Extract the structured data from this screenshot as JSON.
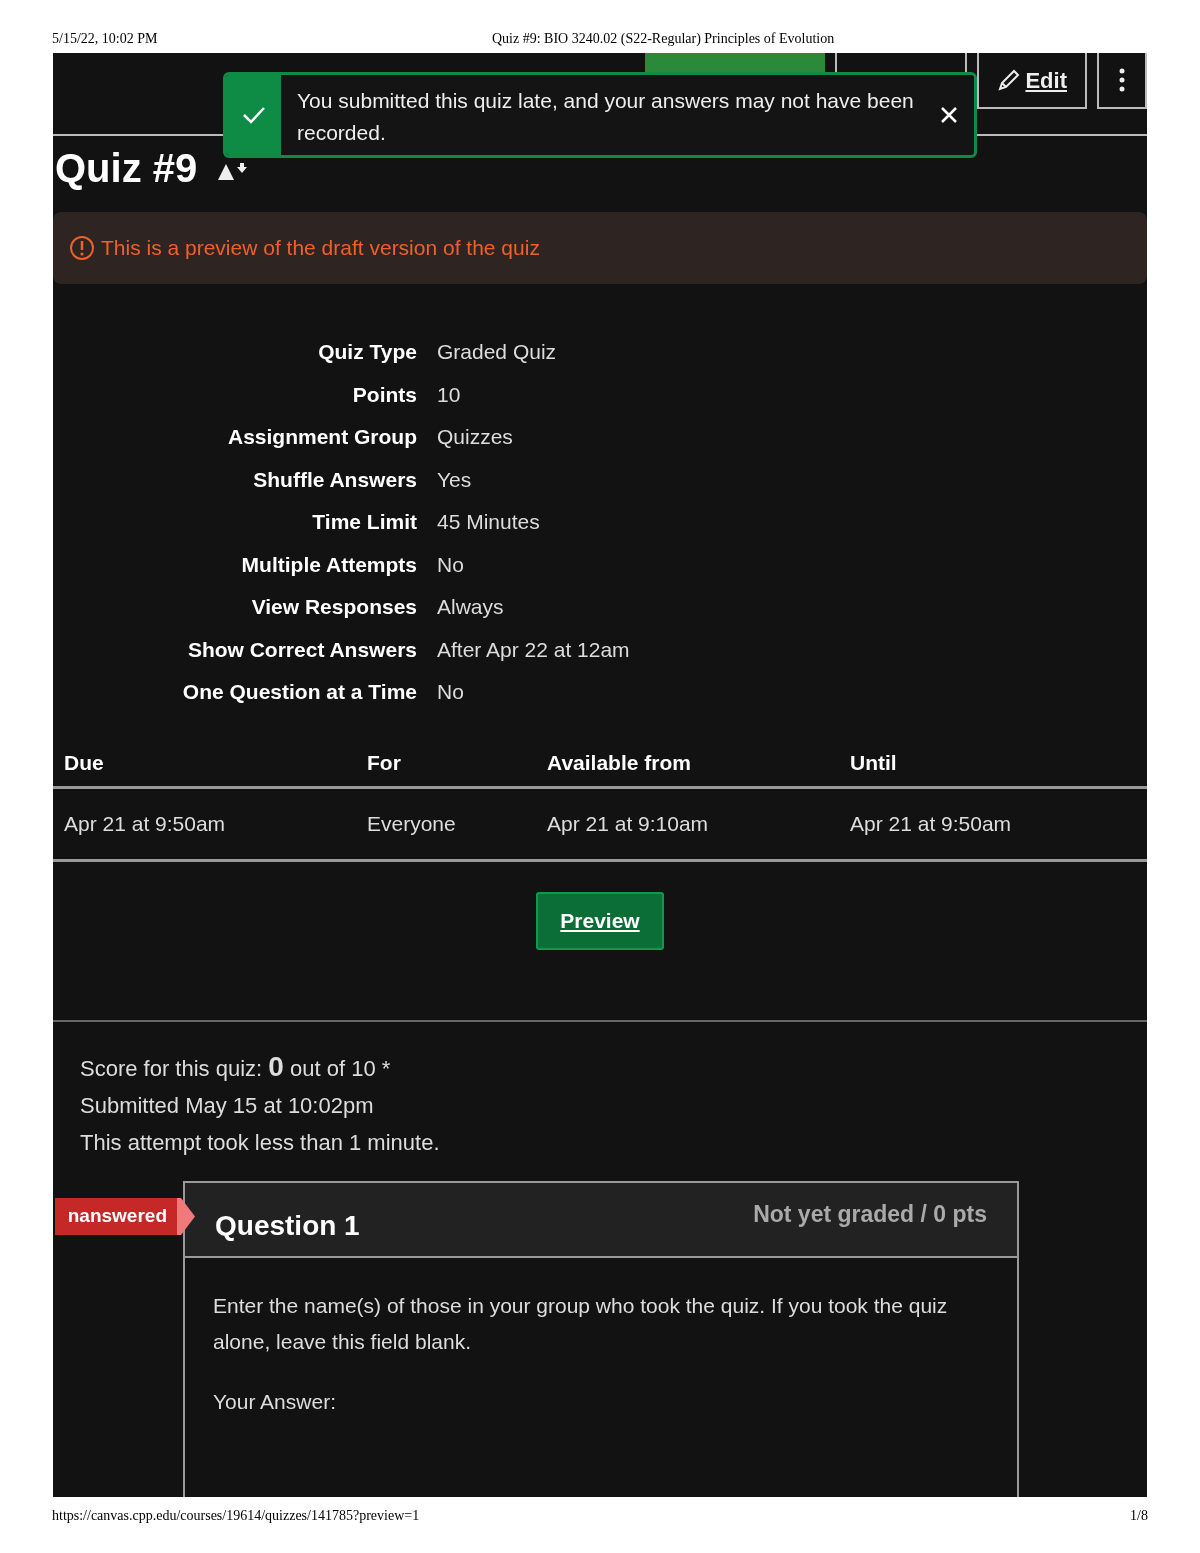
{
  "print_header": {
    "date": "5/15/22, 10:02 PM",
    "title": "Quiz #9: BIO 3240.02 (S22-Regular) Principles of Evolution"
  },
  "toolbar": {
    "edit": "Edit"
  },
  "toast": {
    "message": "You submitted this quiz late, and your answers may not have been recorded."
  },
  "quiz_title": "Quiz #9",
  "preview_notice": "This is a preview of the draft version of the quiz",
  "details": [
    {
      "label": "Quiz Type",
      "value": "Graded Quiz"
    },
    {
      "label": "Points",
      "value": "10"
    },
    {
      "label": "Assignment Group",
      "value": "Quizzes"
    },
    {
      "label": "Shuffle Answers",
      "value": "Yes"
    },
    {
      "label": "Time Limit",
      "value": "45 Minutes"
    },
    {
      "label": "Multiple Attempts",
      "value": "No"
    },
    {
      "label": "View Responses",
      "value": "Always"
    },
    {
      "label": "Show Correct Answers",
      "value": "After Apr 22 at 12am"
    },
    {
      "label": "One Question at a Time",
      "value": "No"
    }
  ],
  "dates_table": {
    "columns": [
      "Due",
      "For",
      "Available from",
      "Until"
    ],
    "rows": [
      [
        "Apr 21 at 9:50am",
        "Everyone",
        "Apr 21 at 9:10am",
        "Apr 21 at 9:50am"
      ]
    ]
  },
  "preview_button": "Preview",
  "submission": {
    "score": "Score for this quiz: **0** out of 10 *",
    "submitted": "Submitted May 15 at 10:02pm",
    "duration": "This attempt took less than 1 minute."
  },
  "question": {
    "status": "nanswered",
    "title": "Question 1",
    "grade": "Not yet graded / 0 pts",
    "text": "Enter the name(s) of those in your group who took the quiz. If you took the quiz alone, leave this field blank.",
    "answer_label": "Your Answer:"
  },
  "print_footer": {
    "url": "https://canvas.cpp.edu/courses/19614/quizzes/141785?preview=1",
    "page": "1/8"
  }
}
